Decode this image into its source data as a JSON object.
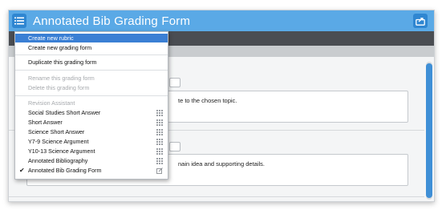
{
  "app": {
    "title": "Annotated Bib Grading Form"
  },
  "content": {
    "row1_text": "te to the chosen topic.",
    "row2_text": "nain idea and supporting details."
  },
  "menu": {
    "create_rubric": "Create new rubric",
    "create_grading_form": "Create new grading form",
    "duplicate": "Duplicate this grading form",
    "rename": "Rename this grading form",
    "delete": "Delete this grading form",
    "section_header": "Revision Assistant",
    "items": [
      {
        "label": "Social Studies Short Answer",
        "icon": "grid-icon"
      },
      {
        "label": "Short Answer",
        "icon": "grid-icon"
      },
      {
        "label": "Science Short Answer",
        "icon": "grid-icon"
      },
      {
        "label": "Y7-9 Science Argument",
        "icon": "grid-icon"
      },
      {
        "label": "Y10-13 Science Argument",
        "icon": "grid-icon"
      },
      {
        "label": "Annotated Bibliography",
        "icon": "grid-icon"
      },
      {
        "label": "Annotated Bib Grading Form",
        "icon": "edit-icon",
        "checked": true
      }
    ],
    "check_mark": "✔"
  },
  "colors": {
    "titlebar": "#5aa9e6",
    "accent": "#3a7fd4",
    "dark_toolbar": "#4a4d52"
  }
}
